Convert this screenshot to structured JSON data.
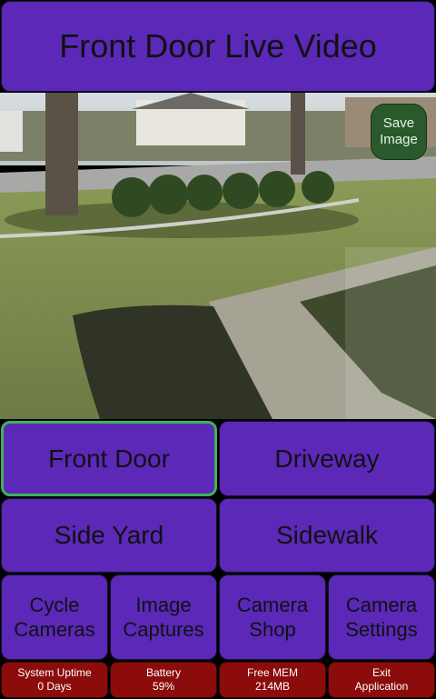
{
  "header": {
    "title": "Front Door Live Video"
  },
  "video": {
    "save_label_line1": "Save",
    "save_label_line2": "Image"
  },
  "cameras": {
    "front_door": "Front Door",
    "driveway": "Driveway",
    "side_yard": "Side Yard",
    "sidewalk": "Sidewalk",
    "active": "Front Door"
  },
  "nav": {
    "cycle": [
      "Cycle",
      "Cameras"
    ],
    "captures": [
      "Image",
      "Captures"
    ],
    "shop": [
      "Camera",
      "Shop"
    ],
    "settings": [
      "Camera",
      "Settings"
    ]
  },
  "status": {
    "uptime_label": "System Uptime",
    "uptime_value": "0 Days",
    "battery_label": "Battery",
    "battery_value": "59%",
    "mem_label": "Free MEM",
    "mem_value": "214MB",
    "exit_line1": "Exit",
    "exit_line2": "Application"
  },
  "colors": {
    "button_purple": "#5b28b8",
    "active_outline": "#3fb25b",
    "status_red": "#8b0c0b",
    "save_green": "#2a5a2c"
  }
}
